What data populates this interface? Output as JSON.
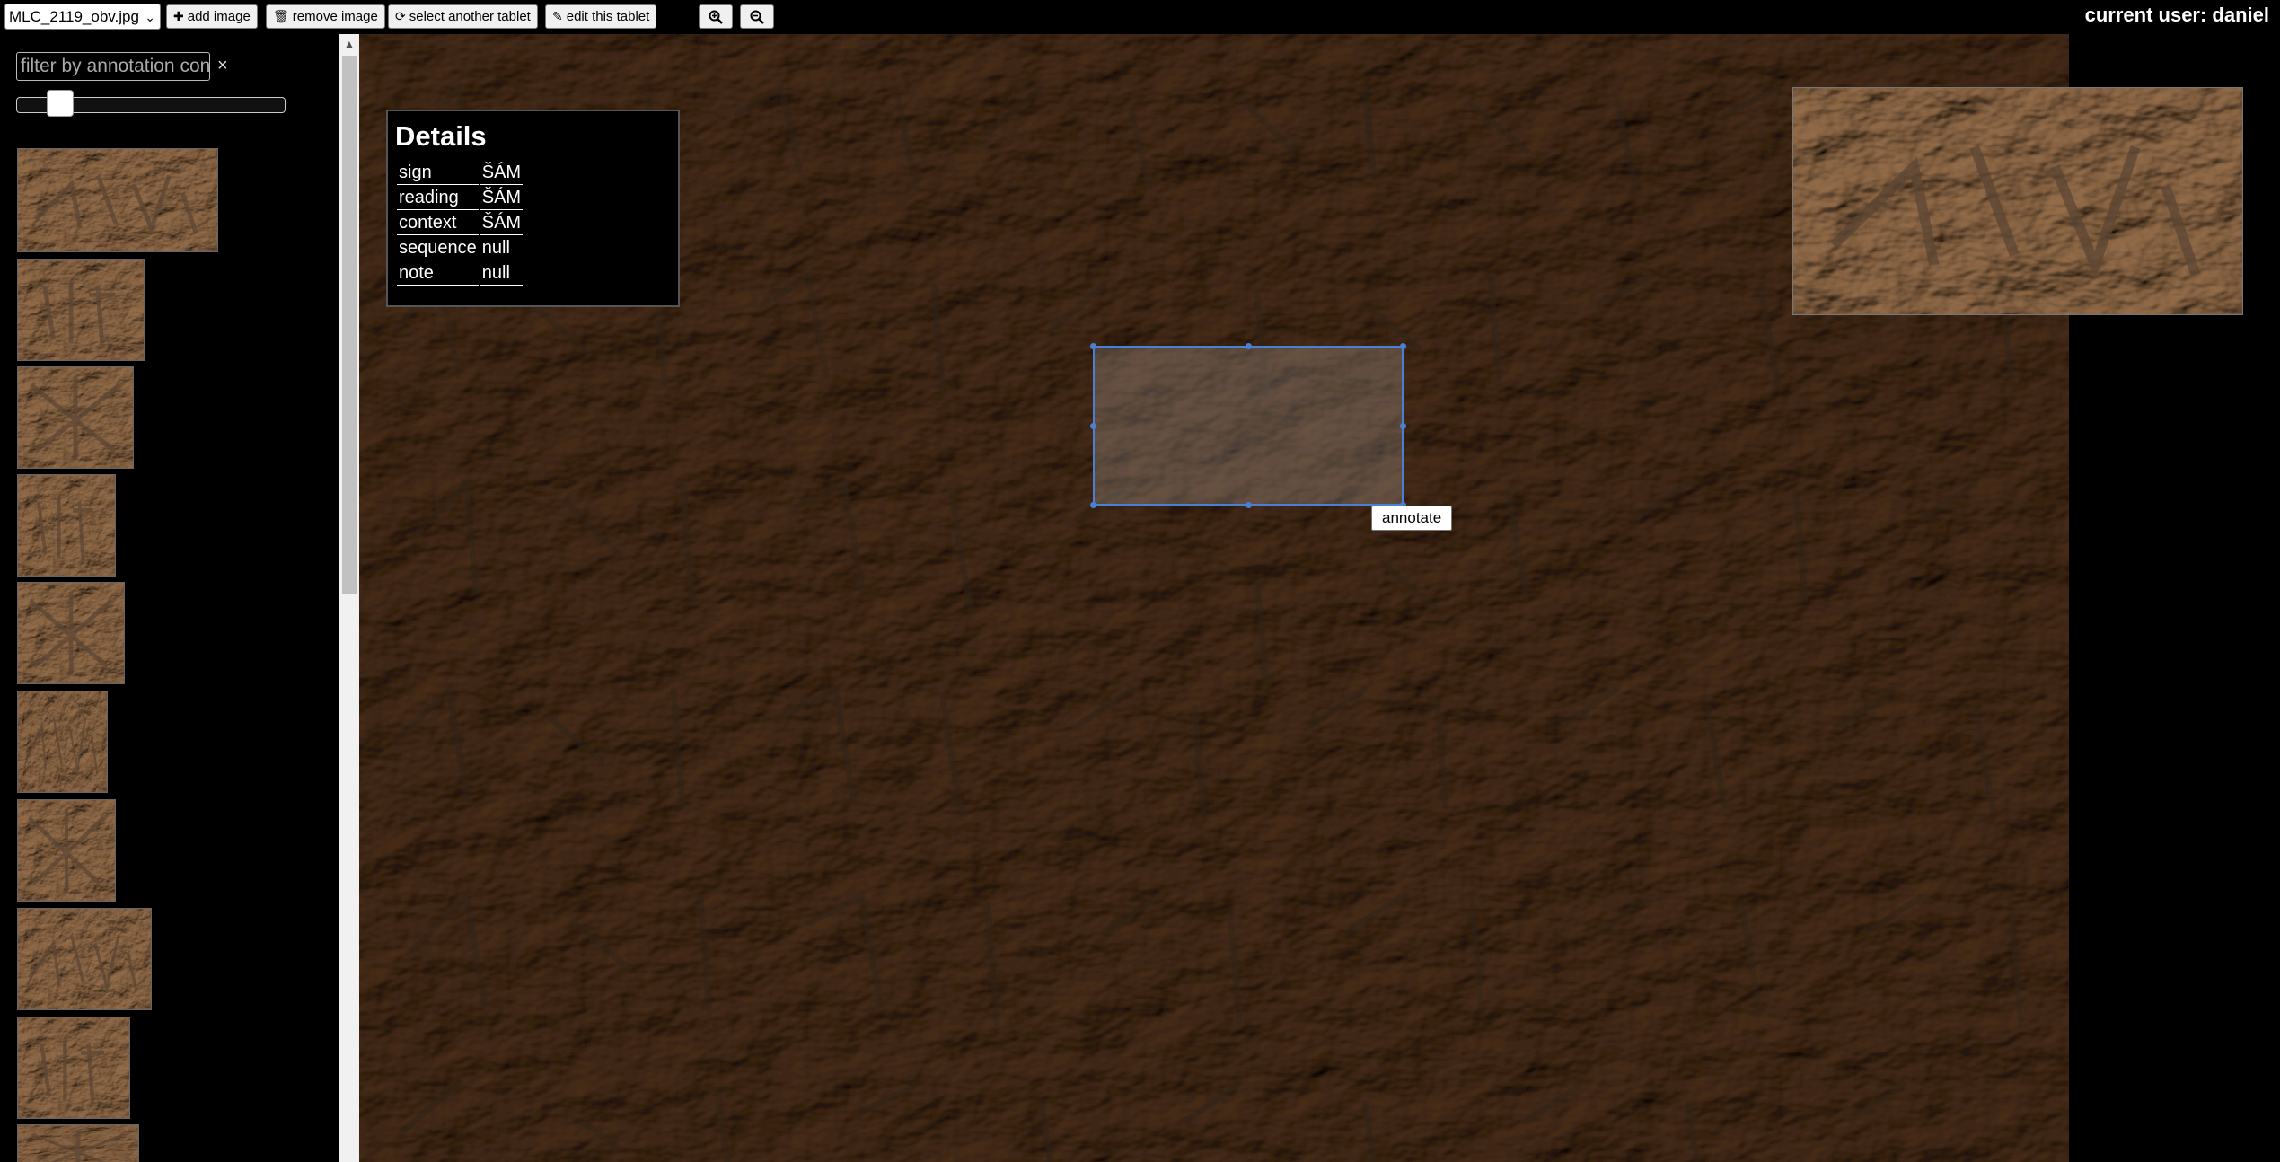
{
  "toolbar": {
    "file_select_value": "MLC_2119_obv.jpg",
    "add_image": "add image",
    "remove_image": "remove image",
    "select_another_tablet": "select another tablet",
    "edit_this_tablet": "edit this tablet",
    "current_user": "current user: daniel"
  },
  "icons": {
    "add": "plus-icon",
    "remove": "trash-icon",
    "select": "refresh-icon",
    "edit": "pencil-icon",
    "zoom_in": "zoom-in-icon",
    "zoom_out": "zoom-out-icon"
  },
  "sidebar": {
    "filter_placeholder": "filter by annotation content",
    "clear_symbol": "×",
    "thumbnail_count_visible": 10
  },
  "details": {
    "title": "Details",
    "rows": [
      {
        "key": "sign",
        "value": "ŠÁM"
      },
      {
        "key": "reading",
        "value": "ŠÁM"
      },
      {
        "key": "context",
        "value": "ŠÁM"
      },
      {
        "key": "sequence",
        "value": "null"
      },
      {
        "key": "note",
        "value": "null"
      }
    ]
  },
  "annotation": {
    "annotate_label": "annotate"
  },
  "colors": {
    "clay_dark": "#4a3a2c",
    "clay_mid": "#6b5440",
    "clay_light": "#a88c70",
    "selection_blue": "#4a7fd6"
  }
}
